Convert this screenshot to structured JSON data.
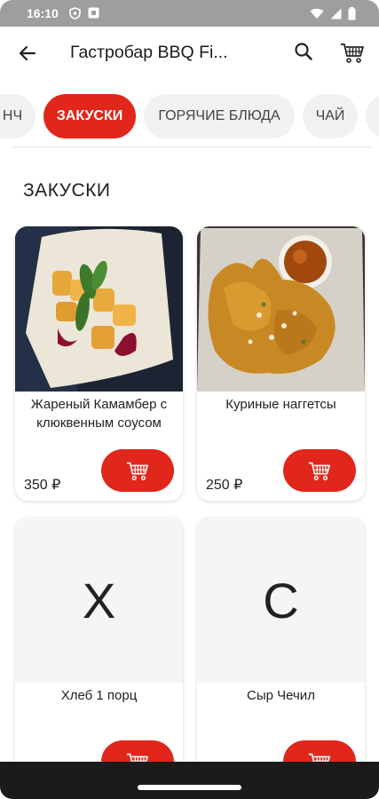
{
  "status_bar": {
    "time": "16:10",
    "left_icons": [
      "vpn-shield-icon",
      "notification-icon"
    ],
    "right_icons": [
      "wifi-icon",
      "signal-icon",
      "battery-icon"
    ]
  },
  "app_bar": {
    "title": "Гастробар BBQ Fi...",
    "back_icon": "arrow-left-icon",
    "search_icon": "search-icon",
    "cart_icon": "cart-icon"
  },
  "tabs": [
    {
      "label": "НЧ",
      "active": false
    },
    {
      "label": "ЗАКУСКИ",
      "active": true
    },
    {
      "label": "ГОРЯЧИЕ БЛЮДА",
      "active": false
    },
    {
      "label": "ЧАЙ",
      "active": false
    },
    {
      "label": "",
      "active": false
    }
  ],
  "section": {
    "title": "ЗАКУСКИ"
  },
  "products": [
    {
      "name": "Жареный Камамбер с клюквенным соусом",
      "price": "350 ₽",
      "image": "camembert-photo",
      "placeholder": ""
    },
    {
      "name": "Куриные наггетсы",
      "price": "250 ₽",
      "image": "nuggets-photo",
      "placeholder": ""
    },
    {
      "name": "Хлеб 1 порц",
      "price": "",
      "image": "",
      "placeholder": "Х"
    },
    {
      "name": "Сыр Чечил",
      "price": "",
      "image": "",
      "placeholder": "С"
    }
  ],
  "colors": {
    "accent": "#e1261c",
    "status_bar": "#9e9e9e",
    "nav_bar": "#1b1b1b"
  }
}
